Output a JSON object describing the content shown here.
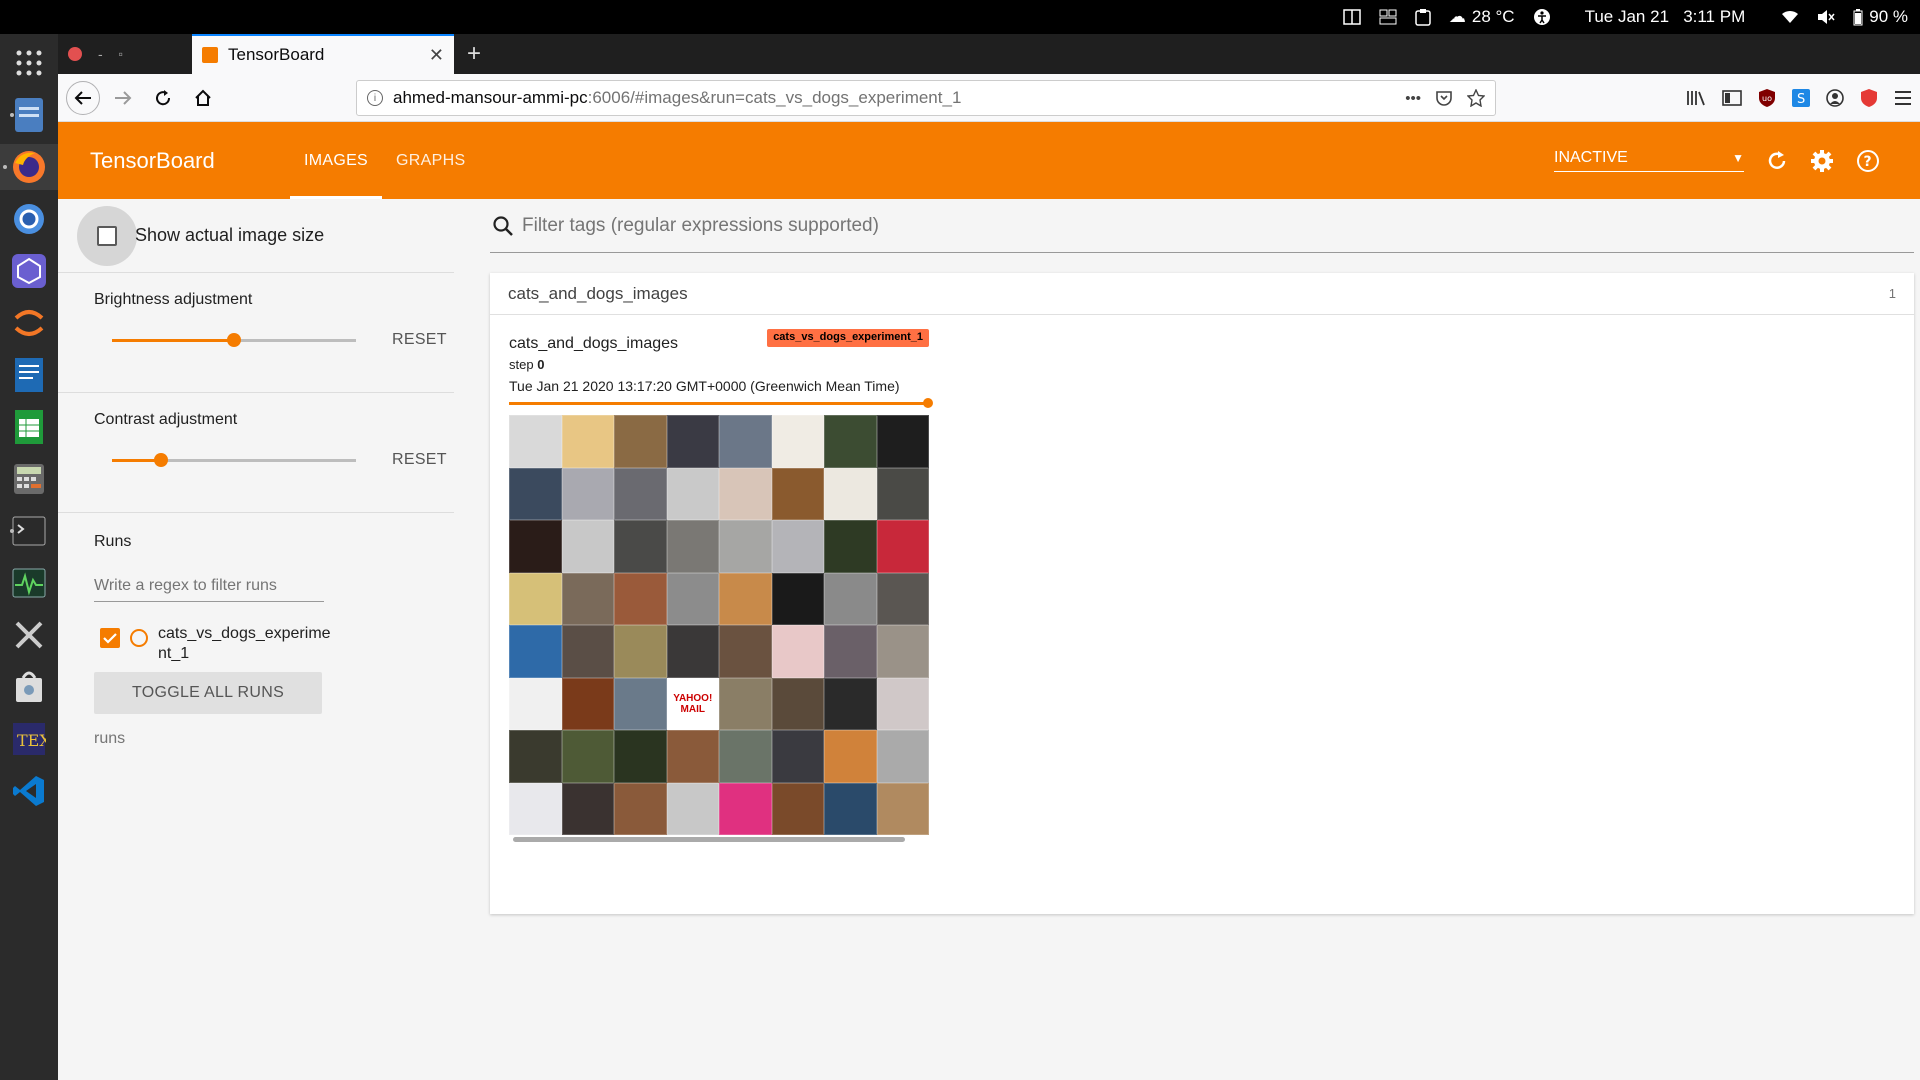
{
  "system": {
    "temperature": "28 °C",
    "datetime": "Tue Jan 21   3:11 PM",
    "battery": "90 %"
  },
  "dock": {
    "items": [
      "apps-grid",
      "file-manager",
      "firefox",
      "chromium",
      "webgl-app",
      "jupyter",
      "writer",
      "calc",
      "calculator",
      "terminal",
      "system-monitor",
      "tools",
      "store",
      "texstudio",
      "vscode"
    ]
  },
  "browser": {
    "tab_title": "TensorBoard",
    "url_host": "ahmed-mansour-ammi-pc",
    "url_rest": ":6006/#images&run=cats_vs_dogs_experiment_1",
    "url_more": "•••"
  },
  "header": {
    "brand": "TensorBoard",
    "tabs": [
      {
        "label": "IMAGES"
      },
      {
        "label": "GRAPHS"
      }
    ],
    "run_selector": "INACTIVE"
  },
  "sidebar": {
    "show_actual_size_label": "Show actual image size",
    "brightness_label": "Brightness adjustment",
    "brightness_value": 0.5,
    "contrast_label": "Contrast adjustment",
    "contrast_value": 0.2,
    "reset_label": "RESET",
    "runs_title": "Runs",
    "regex_placeholder": "Write a regex to filter runs",
    "run_name": "cats_vs_dogs_experime nt_1",
    "toggle_all_label": "TOGGLE ALL RUNS",
    "runs_footer": "runs"
  },
  "main": {
    "filter_placeholder": "Filter tags (regular expressions supported)",
    "card_title": "cats_and_dogs_images",
    "card_count": "1",
    "image_title": "cats_and_dogs_images",
    "run_chip": "cats_vs_dogs_experiment_1",
    "step_label": "step",
    "step_value": "0",
    "timestamp": "Tue Jan 21 2020 13:17:20 GMT+0000 (Greenwich Mean Time)",
    "step_progress": 1.0,
    "grid_label_text": "YAHOO! MAIL",
    "grid_colors": [
      "#d9d9d9",
      "#e8c684",
      "#8a6a44",
      "#3a3a44",
      "#6b7788",
      "#f0ece4",
      "#3c4c32",
      "#1e1e1e",
      "#3b4a5e",
      "#a9a9b0",
      "#6a6a70",
      "#c9c9c9",
      "#d8c5b8",
      "#8a5a2e",
      "#ece8e0",
      "#4a4a46",
      "#2a1c18",
      "#c8c8c8",
      "#4a4a48",
      "#7a7874",
      "#a6a6a4",
      "#b4b4b8",
      "#2e3a24",
      "#c8283a",
      "#d6c078",
      "#7a6a5a",
      "#9a5a3a",
      "#8c8c8c",
      "#c88a4a",
      "#1a1a1a",
      "#8a8a8a",
      "#5a5652",
      "#2e6aa8",
      "#5a4e46",
      "#9a8a5a",
      "#3a3838",
      "#6a5240",
      "#e8c8c8",
      "#6a6068",
      "#9a9288",
      "#f0f0f0",
      "#7a3a1a",
      "#6a7a8a",
      "#ffffff",
      "#8a7e66",
      "#5a4a3a",
      "#2a2a2a",
      "#d0c8c8",
      "#3a3a2e",
      "#4e5a36",
      "#2a3420",
      "#8a5a3a",
      "#6a7468",
      "#3a3a40",
      "#d0823a",
      "#aaaaaa",
      "#e8e8ec",
      "#3a3230",
      "#8a5a3a",
      "#c8c8c8",
      "#e03080",
      "#7a4a2a",
      "#2a4a6a",
      "#b08a60"
    ]
  }
}
